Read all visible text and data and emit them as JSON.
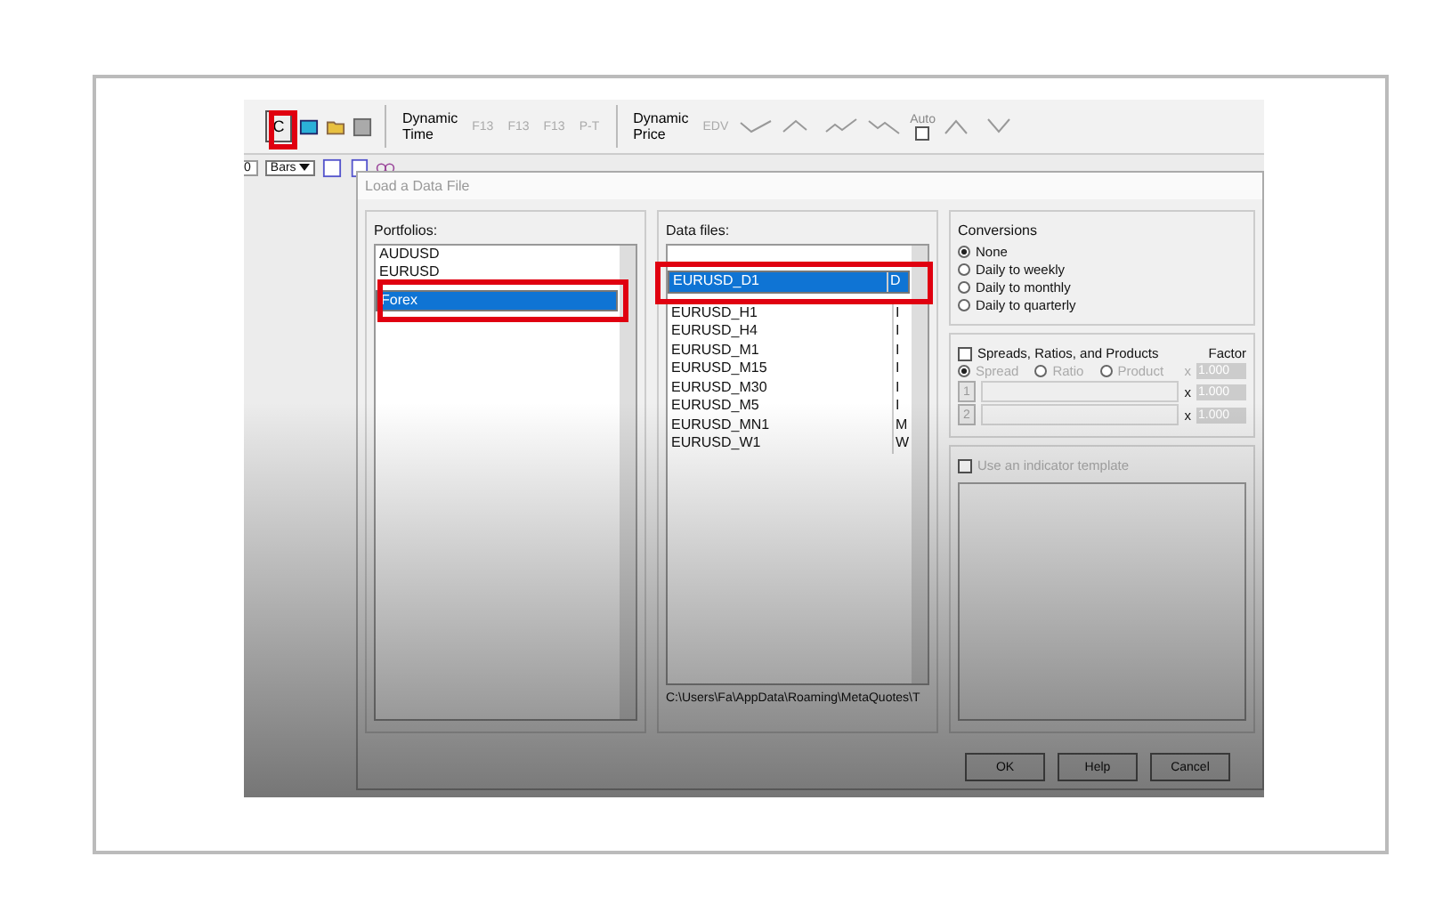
{
  "toolbar": {
    "c_button": "C",
    "dynamic_time": [
      "Dynamic",
      "Time"
    ],
    "f_buttons": [
      "F13",
      "F13",
      "F13",
      "P-T"
    ],
    "dynamic_price": [
      "Dynamic",
      "Price"
    ],
    "edv": "EDV",
    "auto": {
      "label": "Auto",
      "checked": false
    },
    "bars_count": "0",
    "bars_select": "Bars"
  },
  "dialog": {
    "title": "Load a Data File",
    "portfolios": {
      "label": "Portfolios:",
      "items": [
        {
          "name": "AUDUSD",
          "selected": false
        },
        {
          "name": "EURUSD",
          "selected": false
        },
        {
          "name": "Forex",
          "selected": true
        }
      ]
    },
    "data_files": {
      "label": "Data files:",
      "items": [
        {
          "name": "EURUSD_D1",
          "type": "D",
          "selected": true
        },
        {
          "name": "EURUSD_H1",
          "type": "I",
          "selected": false
        },
        {
          "name": "EURUSD_H4",
          "type": "I",
          "selected": false
        },
        {
          "name": "EURUSD_M1",
          "type": "I",
          "selected": false
        },
        {
          "name": "EURUSD_M15",
          "type": "I",
          "selected": false
        },
        {
          "name": "EURUSD_M30",
          "type": "I",
          "selected": false
        },
        {
          "name": "EURUSD_M5",
          "type": "I",
          "selected": false
        },
        {
          "name": "EURUSD_MN1",
          "type": "M",
          "selected": false
        },
        {
          "name": "EURUSD_W1",
          "type": "W",
          "selected": false
        }
      ],
      "path": "C:\\Users\\Fa\\AppData\\Roaming\\MetaQuotes\\T"
    },
    "conversions": {
      "label": "Conversions",
      "options": [
        {
          "label": "None",
          "selected": true
        },
        {
          "label": "Daily to weekly",
          "selected": false
        },
        {
          "label": "Daily to monthly",
          "selected": false
        },
        {
          "label": "Daily to quarterly",
          "selected": false
        }
      ]
    },
    "spreads": {
      "label": "Spreads, Ratios, and Products",
      "checked": false,
      "factor_label": "Factor",
      "modes": [
        {
          "label": "Spread",
          "selected": true
        },
        {
          "label": "Ratio",
          "selected": false
        },
        {
          "label": "Product",
          "selected": false
        }
      ],
      "xs": [
        "x",
        "x",
        "x"
      ],
      "factors": [
        "1.000",
        "1.000",
        "1.000"
      ],
      "slots": [
        "1",
        "2"
      ]
    },
    "indicator": {
      "label": "Use an indicator template",
      "checked": false
    },
    "buttons": [
      "OK",
      "Help",
      "Cancel"
    ]
  }
}
